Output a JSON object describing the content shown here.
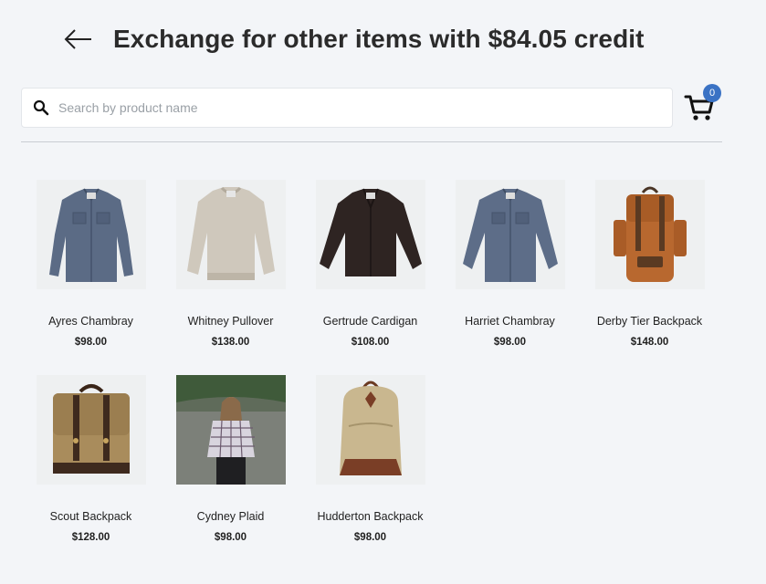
{
  "header": {
    "title": "Exchange for other items with $84.05 credit"
  },
  "search": {
    "placeholder": "Search by product name",
    "value": ""
  },
  "cart": {
    "count": "0"
  },
  "products": [
    {
      "name": "Ayres Chambray",
      "price": "$98.00",
      "image": "shirt-blue"
    },
    {
      "name": "Whitney Pullover",
      "price": "$138.00",
      "image": "sweater-oatmeal"
    },
    {
      "name": "Gertrude Cardigan",
      "price": "$108.00",
      "image": "cardigan-brown"
    },
    {
      "name": "Harriet Chambray",
      "price": "$98.00",
      "image": "shirt-blue"
    },
    {
      "name": "Derby Tier Backpack",
      "price": "$148.00",
      "image": "backpack-orange"
    },
    {
      "name": "Scout Backpack",
      "price": "$128.00",
      "image": "backpack-khaki"
    },
    {
      "name": "Cydney Plaid",
      "price": "$98.00",
      "image": "photo-plaid-model"
    },
    {
      "name": "Hudderton Backpack",
      "price": "$98.00",
      "image": "backpack-tan"
    }
  ],
  "colors": {
    "background": "#f3f5f8",
    "badge": "#3a72c4",
    "text": "#222222"
  }
}
